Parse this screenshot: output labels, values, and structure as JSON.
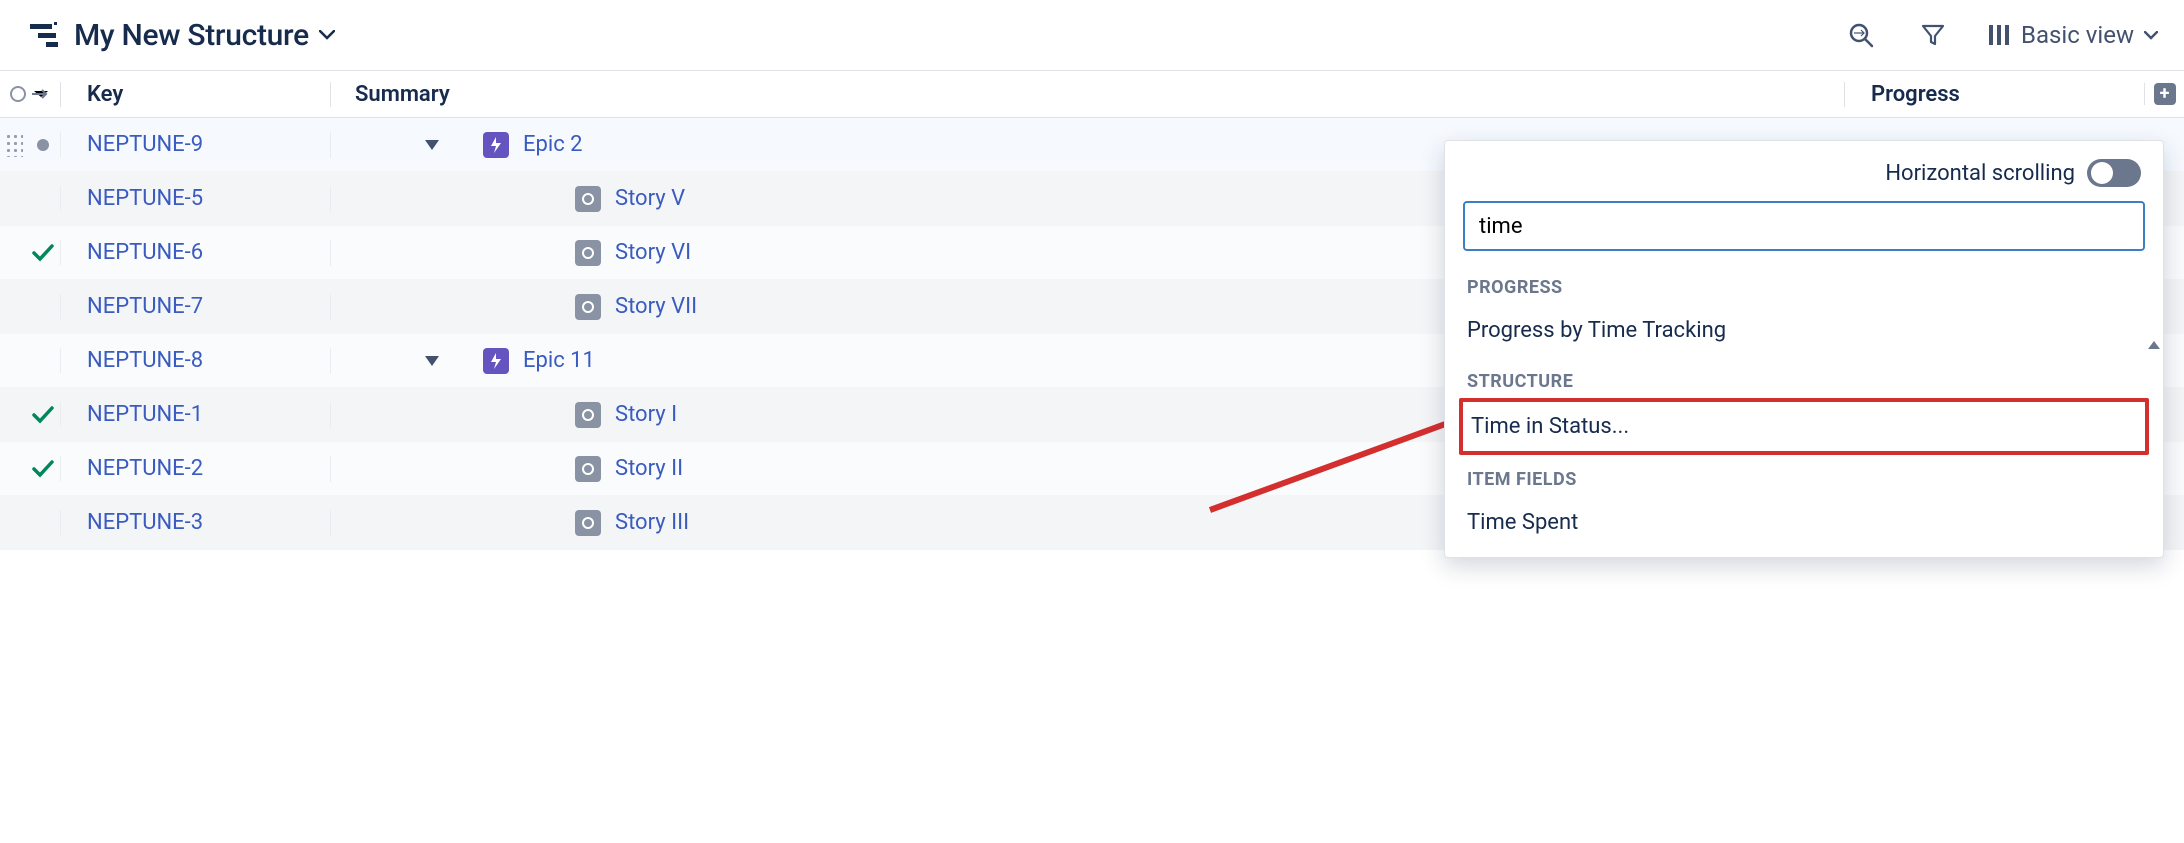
{
  "header": {
    "title": "My New Structure",
    "view_label": "Basic view"
  },
  "columns": {
    "key": "Key",
    "summary": "Summary",
    "progress": "Progress"
  },
  "rows": [
    {
      "key": "NEPTUNE-9",
      "summary": "Epic 2",
      "type": "epic",
      "indent": 0,
      "status": "dot",
      "expandable": true,
      "selected": true
    },
    {
      "key": "NEPTUNE-5",
      "summary": "Story V",
      "type": "story",
      "indent": 1,
      "status": "none",
      "expandable": false,
      "selected": false
    },
    {
      "key": "NEPTUNE-6",
      "summary": "Story VI",
      "type": "story",
      "indent": 1,
      "status": "check",
      "expandable": false,
      "selected": false
    },
    {
      "key": "NEPTUNE-7",
      "summary": "Story VII",
      "type": "story",
      "indent": 1,
      "status": "none",
      "expandable": false,
      "selected": false
    },
    {
      "key": "NEPTUNE-8",
      "summary": "Epic 11",
      "type": "epic",
      "indent": 0,
      "status": "none",
      "expandable": true,
      "selected": false
    },
    {
      "key": "NEPTUNE-1",
      "summary": "Story I",
      "type": "story",
      "indent": 1,
      "status": "check",
      "expandable": false,
      "selected": false
    },
    {
      "key": "NEPTUNE-2",
      "summary": "Story II",
      "type": "story",
      "indent": 1,
      "status": "check",
      "expandable": false,
      "selected": false
    },
    {
      "key": "NEPTUNE-3",
      "summary": "Story III",
      "type": "story",
      "indent": 1,
      "status": "none",
      "expandable": false,
      "selected": false
    }
  ],
  "popover": {
    "hscroll_label": "Horizontal scrolling",
    "search_value": "time",
    "groups": [
      {
        "label": "PROGRESS",
        "items": [
          "Progress by Time Tracking"
        ]
      },
      {
        "label": "STRUCTURE",
        "items": [
          "Time in Status..."
        ]
      },
      {
        "label": "ITEM FIELDS",
        "items": [
          "Time Spent"
        ]
      }
    ],
    "highlighted_item": "Time in Status..."
  }
}
